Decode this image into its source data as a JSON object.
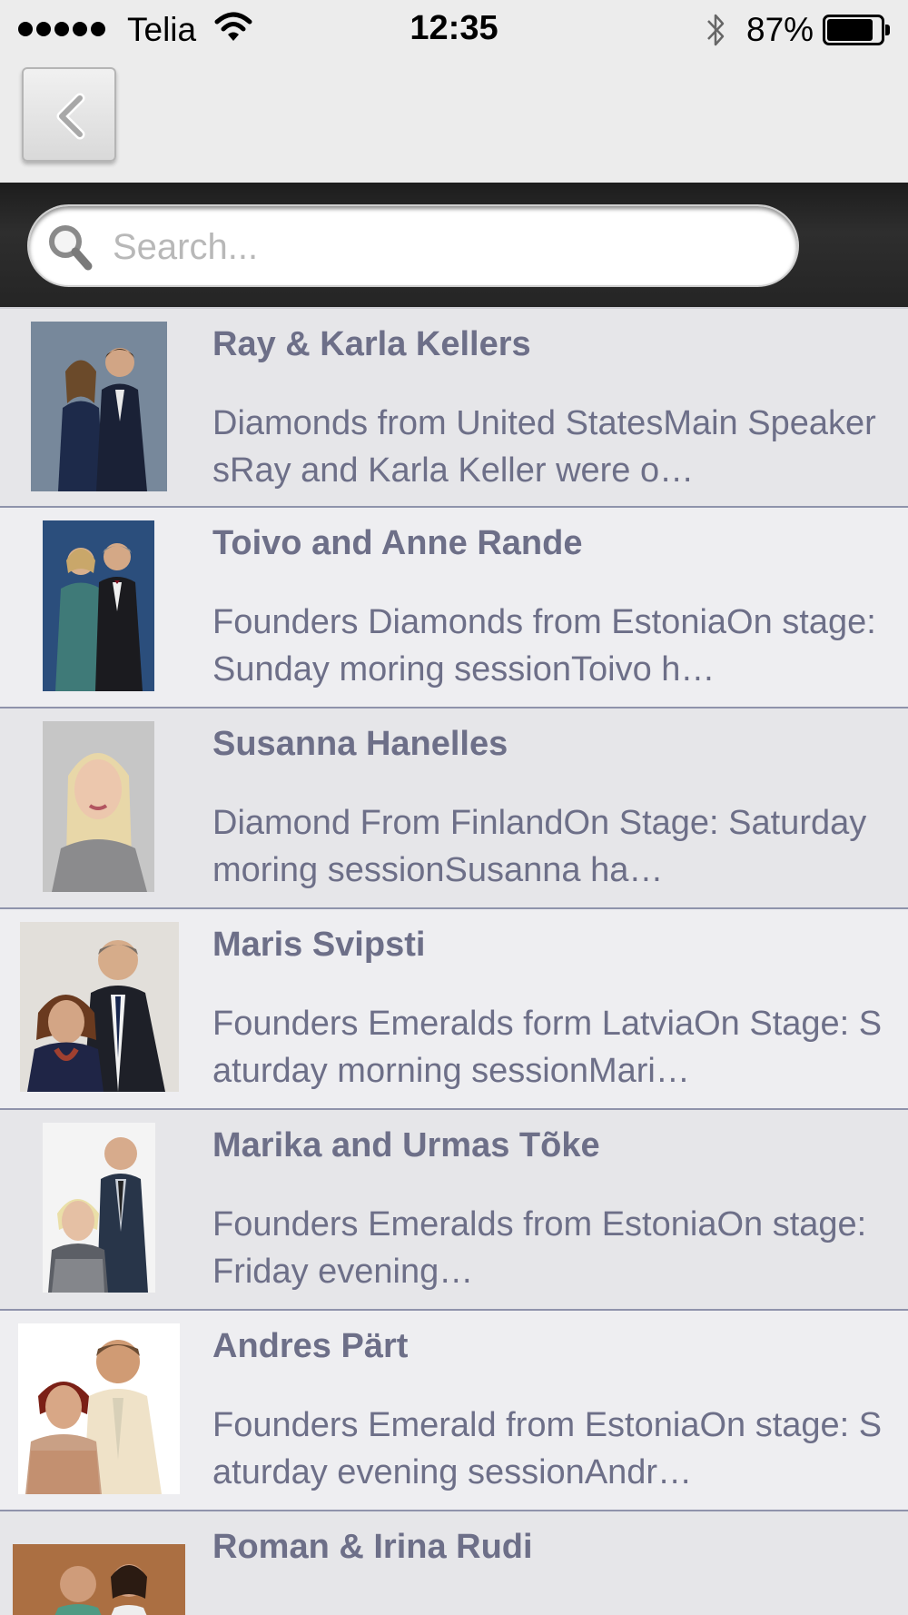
{
  "status_bar": {
    "carrier": "Telia",
    "time": "12:35",
    "battery_percent": "87%",
    "battery_level": 0.87
  },
  "nav": {
    "back_icon": "chevron-left-icon"
  },
  "search": {
    "placeholder": "Search..."
  },
  "speakers": [
    {
      "name": "Ray & Karla Kellers",
      "description": "Diamonds from United StatesMain SpeakersRay and Karla Keller were o…"
    },
    {
      "name": "Toivo and Anne Rande",
      "description": "Founders Diamonds from EstoniaOn stage: Sunday moring sessionToivo h…"
    },
    {
      "name": "Susanna Hanelles",
      "description": "Diamond From FinlandOn Stage: Saturday moring sessionSusanna ha…"
    },
    {
      "name": " Maris Svipsti",
      "description": "Founders Emeralds form LatviaOn Stage: Saturday morning sessionMari…"
    },
    {
      "name": "Marika and Urmas Tõke",
      "description": "Founders Emeralds from EstoniaOn stage: Friday evening…"
    },
    {
      "name": "Andres Pärt",
      "description": "Founders Emerald from EstoniaOn stage: Saturday evening sessionAndr…"
    },
    {
      "name": "Roman & Irina Rudi",
      "description": ""
    }
  ]
}
